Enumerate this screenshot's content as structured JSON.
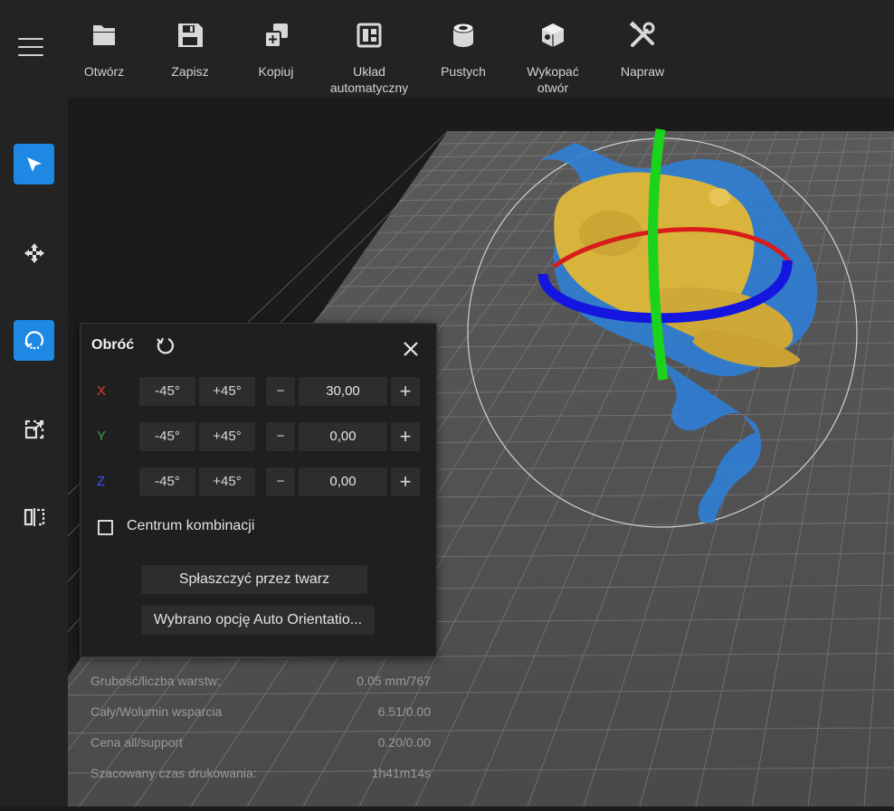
{
  "toolbar": {
    "items": [
      {
        "label": "Otwórz",
        "icon": "folder-icon"
      },
      {
        "label": "Zapisz",
        "icon": "save-icon"
      },
      {
        "label": "Kopiuj",
        "icon": "copy-icon"
      },
      {
        "label": "Układ\nautomatyczny",
        "icon": "layout-icon"
      },
      {
        "label": "Pustych",
        "icon": "hollow-icon"
      },
      {
        "label": "Wykopać\notwór",
        "icon": "dig-hole-icon"
      },
      {
        "label": "Napraw",
        "icon": "repair-icon"
      }
    ]
  },
  "sidebar": {
    "items": [
      {
        "name": "select",
        "icon": "cursor-icon",
        "active": true
      },
      {
        "name": "move",
        "icon": "move-icon",
        "active": false
      },
      {
        "name": "rotate",
        "icon": "rotate-icon",
        "active": true
      },
      {
        "name": "scale",
        "icon": "scale-icon",
        "active": false
      },
      {
        "name": "mirror",
        "icon": "mirror-icon",
        "active": false
      }
    ]
  },
  "rotate_panel": {
    "title": "Obróć",
    "minus_label": "-45°",
    "plus_label": "+45°",
    "decrement": "−",
    "increment": "+",
    "axes": [
      {
        "label": "X",
        "value": "30,00",
        "color": "#e53935"
      },
      {
        "label": "Y",
        "value": "0,00",
        "color": "#43a047"
      },
      {
        "label": "Z",
        "value": "0,00",
        "color": "#3f51f5"
      }
    ],
    "checkbox_label": "Centrum kombinacji",
    "checked": false,
    "flatten_button": "Spłaszczyć przez twarz",
    "auto_orient_button": "Wybrano opcję Auto Orientatio..."
  },
  "stats": [
    {
      "label": "Grubość/liczba warstw:",
      "value": "0.05 mm/767"
    },
    {
      "label": "Cały/Wolumin wsparcia",
      "value": "6.51/0.00"
    },
    {
      "label": "Cena all/support",
      "value": "0.20/0.00"
    },
    {
      "label": "Szacowany czas drukowania:",
      "value": "1h41m14s"
    }
  ],
  "colors": {
    "accent": "#1e88e5",
    "gizmo_x": "#d81b1b",
    "gizmo_y": "#1bd31b",
    "gizmo_z": "#1515e0",
    "model": "#d9b43c",
    "supports": "#2f7fd6"
  }
}
